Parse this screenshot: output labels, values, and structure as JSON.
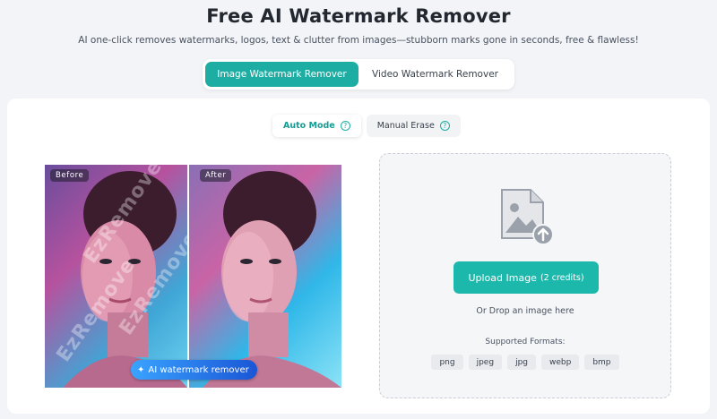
{
  "header": {
    "title": "Free AI Watermark Remover",
    "subtitle": "AI one-click removes watermarks, logos, text & clutter from images—stubborn marks gone in seconds, free & flawless!"
  },
  "mode_tabs": [
    {
      "label": "Image Watermark Remover",
      "active": true
    },
    {
      "label": "Video Watermark Remover",
      "active": false
    }
  ],
  "sub_tabs": [
    {
      "label": "Auto Mode",
      "active": true
    },
    {
      "label": "Manual Erase",
      "active": false
    }
  ],
  "preview": {
    "before_label": "Before",
    "after_label": "After",
    "watermark_text": "EzRemove",
    "pill_label": "AI watermark remover"
  },
  "upload": {
    "button_label": "Upload Image",
    "credits": "(2 credits)",
    "drop_hint": "Or Drop an image here",
    "formats_label": "Supported Formats:",
    "formats": [
      "png",
      "jpeg",
      "jpg",
      "webp",
      "bmp"
    ]
  },
  "colors": {
    "accent": "#1dada2",
    "upload_button": "#1db8ac",
    "pill_gradient_start": "#3aa3ff",
    "pill_gradient_end": "#1a56d6"
  }
}
